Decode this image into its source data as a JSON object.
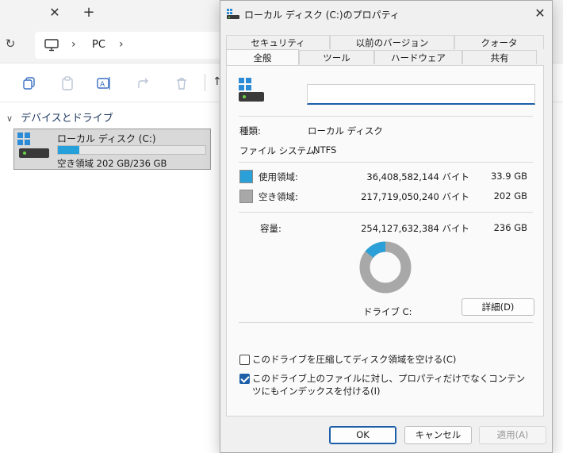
{
  "explorer": {
    "address": {
      "location": "PC"
    },
    "group": {
      "title": "デバイスとドライブ"
    },
    "drive": {
      "name": "ローカル ディスク (C:)",
      "free_text": "空き領域 202 GB/236 GB",
      "used_fraction": 0.143
    }
  },
  "dialog": {
    "title": "ローカル ディスク (C:)のプロパティ",
    "tabs_top": [
      "セキュリティ",
      "以前のバージョン",
      "クォータ"
    ],
    "tabs_bottom": [
      "全般",
      "ツール",
      "ハードウェア",
      "共有"
    ],
    "active_tab": "全般",
    "name_value": "",
    "type_label": "種類:",
    "type_value": "ローカル ディスク",
    "fs_label": "ファイル システム:",
    "fs_value": "NTFS",
    "used_label": "使用領域:",
    "used_bytes": "36,408,582,144 バイト",
    "used_size": "33.9 GB",
    "free_label": "空き領域:",
    "free_bytes": "217,719,050,240 バイト",
    "free_size": "202 GB",
    "capacity_label": "容量:",
    "capacity_bytes": "254,127,632,384 バイト",
    "capacity_size": "236 GB",
    "drive_label": "ドライブ C:",
    "details_button": "詳細(D)",
    "compress_label": "このドライブを圧縮してディスク領域を空ける(C)",
    "compress_checked": false,
    "index_label": "このドライブ上のファイルに対し、プロパティだけでなくコンテンツにもインデックスを付ける(I)",
    "index_checked": true,
    "ok_button": "OK",
    "cancel_button": "キャンセル",
    "apply_button": "適用(A)",
    "used_fraction": 0.143,
    "colors": {
      "used": "#2a9fd8",
      "free": "#a8a8a8"
    }
  }
}
